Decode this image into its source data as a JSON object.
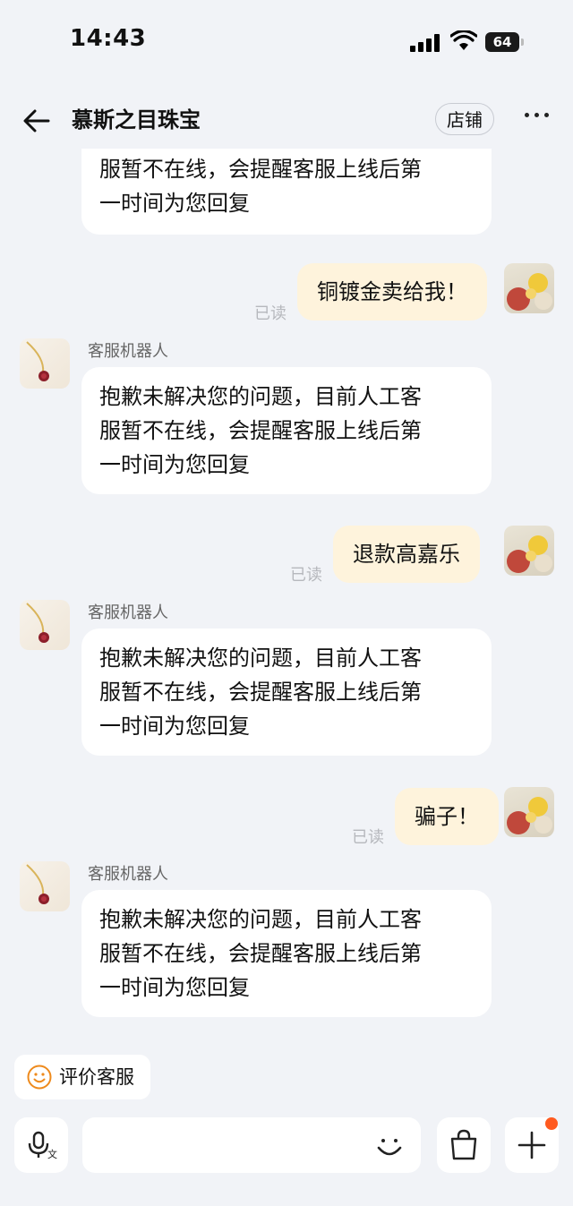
{
  "status_bar": {
    "time": "14:43",
    "battery": "64"
  },
  "header": {
    "title": "慕斯之目珠宝",
    "store_button": "店铺"
  },
  "messages": [
    {
      "from": "bot",
      "lines": [
        "服暂不在线，会提醒客服上线后第",
        "一时间为您回复"
      ]
    },
    {
      "from": "me",
      "text": "铜镀金卖给我！",
      "status": "已读"
    },
    {
      "from": "bot",
      "name": "客服机器人",
      "lines": [
        "抱歉未解决您的问题，目前人工客",
        "服暂不在线，会提醒客服上线后第",
        "一时间为您回复"
      ]
    },
    {
      "from": "me",
      "text": "退款高嘉乐",
      "status": "已读"
    },
    {
      "from": "bot",
      "name": "客服机器人",
      "lines": [
        "抱歉未解决您的问题，目前人工客",
        "服暂不在线，会提醒客服上线后第",
        "一时间为您回复"
      ]
    },
    {
      "from": "me",
      "text": "骗子！",
      "status": "已读"
    },
    {
      "from": "bot",
      "name": "客服机器人",
      "lines": [
        "抱歉未解决您的问题，目前人工客",
        "服暂不在线，会提醒客服上线后第",
        "一时间为您回复"
      ]
    }
  ],
  "quick_action": {
    "label": "评价客服",
    "icon": "smile-icon"
  },
  "input_bar": {
    "icons": [
      "voice-to-text-icon",
      "emoji-icon",
      "shopping-bag-icon",
      "plus-icon"
    ],
    "accent": "#ff5a1f"
  },
  "colors": {
    "background": "#f1f3f7",
    "my_bubble": "#fef3dc",
    "bot_bubble": "#ffffff"
  }
}
